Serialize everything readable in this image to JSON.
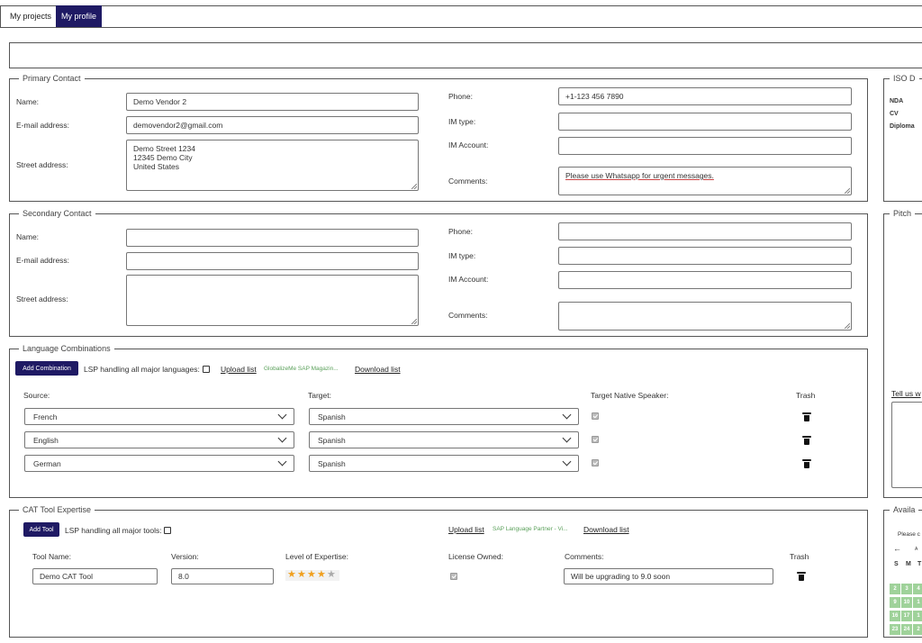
{
  "tabs": [
    {
      "label": "My projects"
    },
    {
      "label": "My profile"
    }
  ],
  "primary": {
    "legend": "Primary Contact",
    "name_label": "Name:",
    "name_value": "Demo Vendor 2",
    "email_label": "E-mail address:",
    "email_value": "demovendor2@gmail.com",
    "street_label": "Street address:",
    "street_value": "Demo Street 1234\n12345 Demo City\nUnited States",
    "phone_label": "Phone:",
    "phone_value": "+1-123 456 7890",
    "imtype_label": "IM type:",
    "imtype_value": "",
    "imaccount_label": "IM Account:",
    "imaccount_value": "",
    "comments_label": "Comments:",
    "comments_value": "Please use Whatsapp for urgent messages."
  },
  "secondary": {
    "legend": "Secondary Contact",
    "name_label": "Name:",
    "email_label": "E-mail address:",
    "street_label": "Street address:",
    "phone_label": "Phone:",
    "imtype_label": "IM type:",
    "imaccount_label": "IM Account:",
    "comments_label": "Comments:"
  },
  "languages": {
    "legend": "Language Combinations",
    "add_button": "Add Combination",
    "lsp_label": "LSP handling all major languages:",
    "upload_link": "Upload list",
    "green_text": "GlobalizeMe SAP Magazin...",
    "download_link": "Download list",
    "col_source": "Source:",
    "col_target": "Target:",
    "col_native": "Target Native Speaker:",
    "col_trash": "Trash",
    "rows": [
      {
        "source": "French",
        "target": "Spanish",
        "native": true
      },
      {
        "source": "English",
        "target": "Spanish",
        "native": true
      },
      {
        "source": "German",
        "target": "Spanish",
        "native": true
      }
    ]
  },
  "cat": {
    "legend": "CAT Tool Expertise",
    "add_button": "Add Tool",
    "lsp_label": "LSP handling all major tools:",
    "upload_link": "Upload list",
    "green_text": "SAP Language Partner - Vi...",
    "download_link": "Download list",
    "col_tool": "Tool Name:",
    "col_version": "Version:",
    "col_level": "Level of Expertise:",
    "col_license": "License Owned:",
    "col_comments": "Comments:",
    "col_trash": "Trash",
    "rows": [
      {
        "tool": "Demo CAT Tool",
        "version": "8.0",
        "level": 4,
        "level_max": 5,
        "license": true,
        "comments": "Will be upgrading to 9.0 soon"
      }
    ]
  },
  "iso": {
    "legend": "ISO D",
    "items": [
      "NDA",
      "CV",
      "Diploma"
    ]
  },
  "pitch": {
    "legend": "Pitch",
    "link": "Tell us w"
  },
  "availability": {
    "legend": "Availa",
    "hint": "Please c",
    "month_partial": "A",
    "weekdays": [
      "S",
      "M",
      "T"
    ],
    "days": [
      [
        "2",
        "3",
        "4"
      ],
      [
        "9",
        "10",
        "1"
      ],
      [
        "16",
        "17",
        "1"
      ],
      [
        "23",
        "24",
        "2"
      ]
    ]
  },
  "colors": {
    "accent": "#1f1a64",
    "green": "#9fd29a",
    "star": "#f0a020",
    "star_off": "#aaaaaa"
  }
}
